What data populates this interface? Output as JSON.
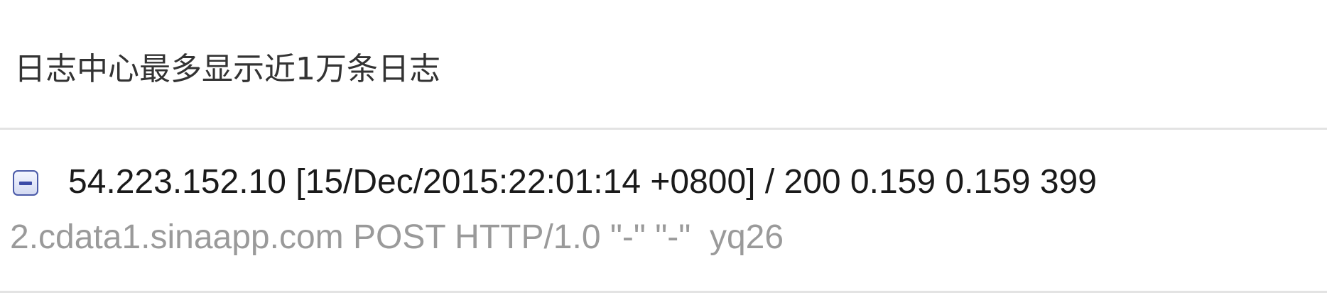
{
  "notice": {
    "text": "日志中心最多显示近1万条日志"
  },
  "log_entry": {
    "toggle_icon": "collapse-minus-icon",
    "summary": "54.223.152.10 [15/Dec/2015:22:01:14 +0800] / 200 0.159 0.159 399",
    "detail": "2.cdata1.sinaapp.com POST HTTP/1.0 \"-\" \"-\"  yq26",
    "colors": {
      "summary": "#1a1a1a",
      "detail": "#9a9a9a",
      "toggle_border": "#4a5aa8"
    }
  }
}
